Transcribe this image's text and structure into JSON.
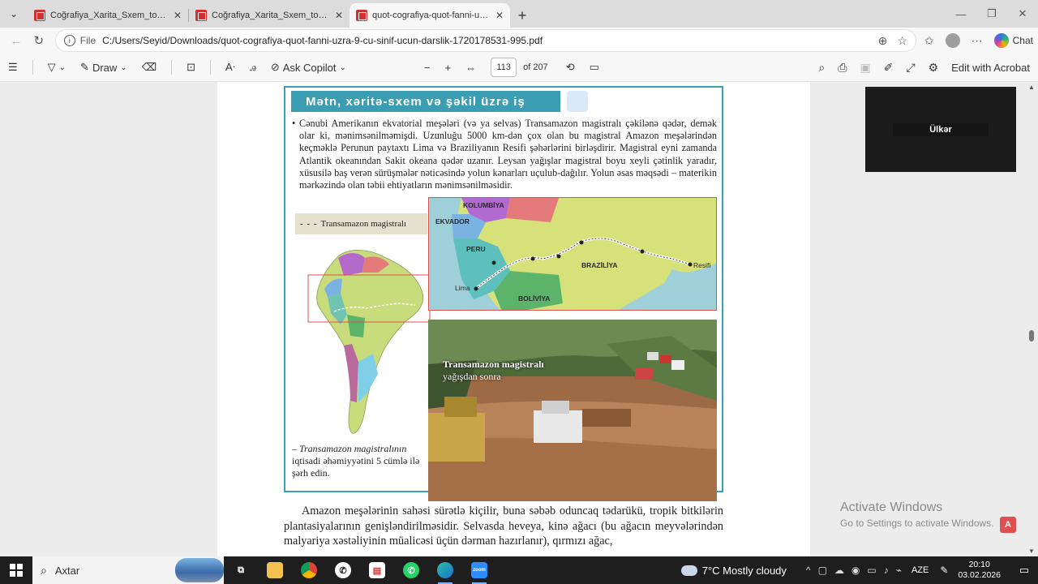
{
  "tabs": [
    {
      "title": "Coğrafiya_Xarita_Sxem_toplusu_Fə",
      "active": false
    },
    {
      "title": "Coğrafiya_Xarita_Sxem_toplusu_Fə",
      "active": false
    },
    {
      "title": "quot-cografiya-quot-fanni-uzra-9",
      "active": true
    }
  ],
  "address": {
    "file_label": "File",
    "url": "C:/Users/Seyid/Downloads/quot-cografiya-quot-fanni-uzra-9-cu-sinif-ucun-darslik-1720178531-995.pdf",
    "chat_label": "Chat"
  },
  "pdf_toolbar": {
    "draw_label": "Draw",
    "copilot_label": "Ask Copilot",
    "page_current": "113",
    "page_total": "of 207",
    "acrobat_label": "Edit with Acrobat"
  },
  "document": {
    "section_title": "Mətn, xəritə-sxem və şəkil üzrə iş",
    "bullet": "•",
    "paragraph": "Cənubi Amerikanın ekvatorial meşələri (və ya selvas) Transamazon magistralı çəkilənə qədər, demək olar ki, mənimsənilməmişdi. Uzunluğu 5000 km-dən çox olan bu magistral Amazon meşələrindən keçməklə Perunun paytaxtı Lima və Braziliyanın Resifi şəhərlərini birləşdirir. Magistral eyni zamanda Atlantik okeanından Sakit okeana qədər uzanır. Leysan yağışlar magistral boyu xeyli çətinlik yaradır, xüsusilə baş verən sürüşmələr nəticəsində yolun kənarları uçulub-dağılır. Yolun əsas məqsədi – materikin mərkəzində olan təbii ehtiyatların mənimsənilməsidir.",
    "legend_symbol": "- - -",
    "legend_label": "Transamazon magistralı",
    "map_labels": {
      "colombia": "KOLUMBİYA",
      "ecuador": "EKVADOR",
      "peru": "PERU",
      "brazil": "BRAZİLİYA",
      "bolivia": "BOLİVİYA",
      "lima": "Lima",
      "recife": "Resifi"
    },
    "photo_caption_bold": "Transamazon magistralı",
    "photo_caption_rest": "yağışdan sonra",
    "task_dash": "–",
    "task_italic": "Transamazon magistralının",
    "task_rest": "iqtisadi əhəmiyyətini 5 cümlə ilə şərh edin.",
    "body": "Amazon meşələrinin sahəsi sürətlə kiçilir, buna səbəb oduncaq tədarükü, tropik bitkilərin plantasiyalarının genişləndirilməsidir. Selvasda heveya, kinə ağacı (bu ağacın meyvələrindən malyariya xəstəliyinin müalicəsi üçün dərman hazırlanır), qırmızı ağac,"
  },
  "video_tile": {
    "name": "Ülkər"
  },
  "watermark": {
    "line1": "Activate Windows",
    "line2": "Go to Settings to activate Windows."
  },
  "taskbar": {
    "search_placeholder": "Axtar",
    "weather": "7°C  Mostly cloudy",
    "language": "AZE",
    "time": "20:10",
    "date": "03.02.2026"
  },
  "colors": {
    "accent_teal": "#3b9db2",
    "inset_border": "#d9534f",
    "taskbar_bg": "#1e1e1e"
  }
}
